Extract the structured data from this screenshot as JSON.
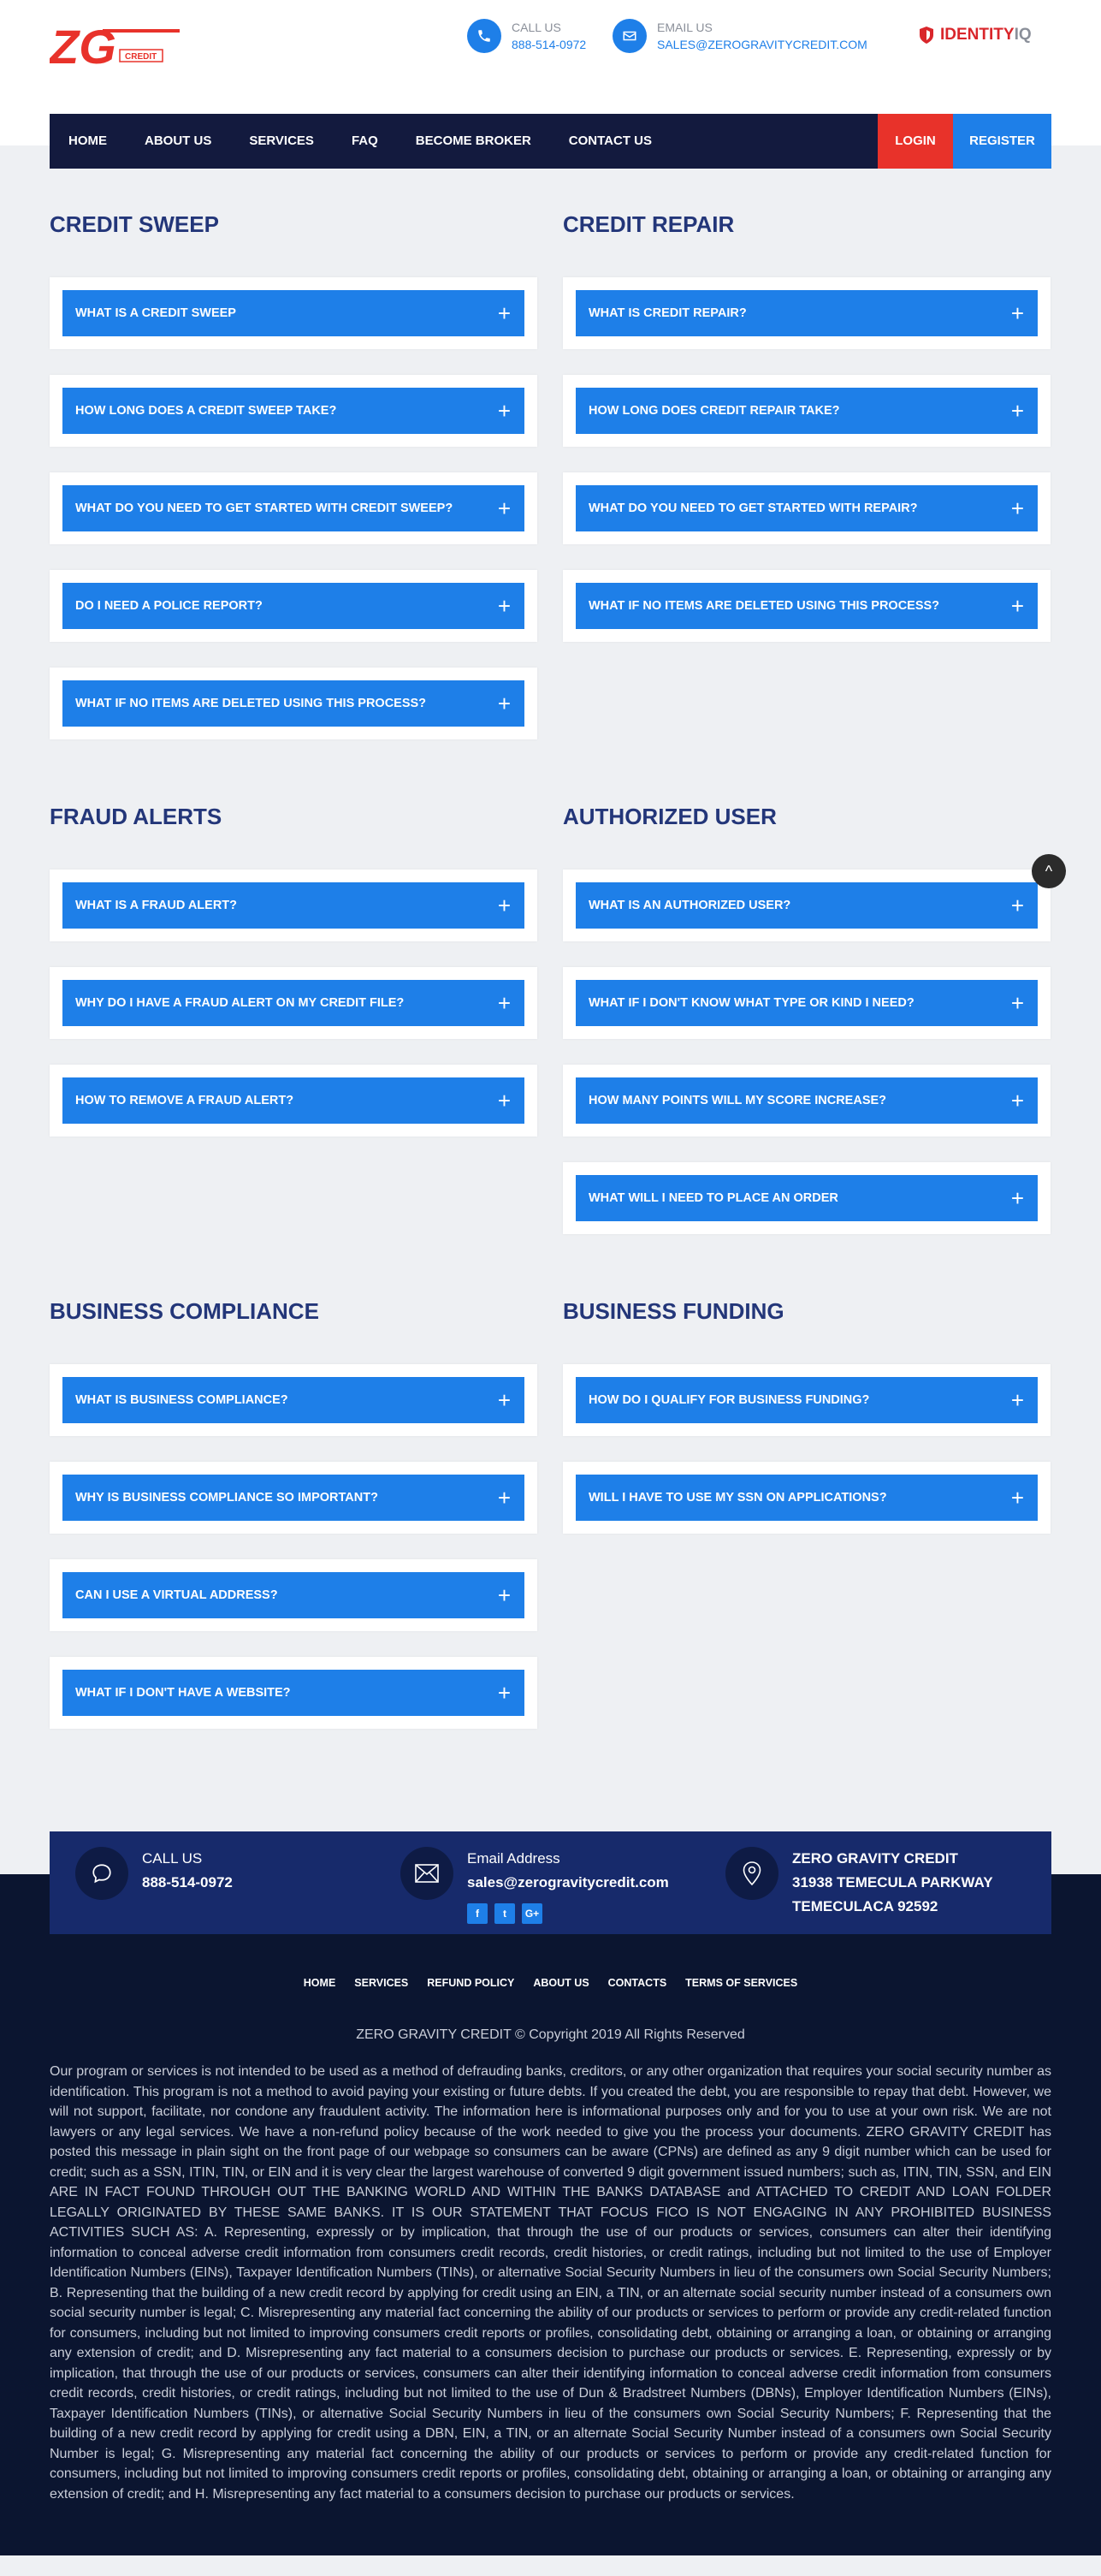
{
  "header": {
    "logo_text": "ZG",
    "logo_sub": "CREDIT",
    "call_label": "CALL US",
    "call_value": "888-514-0972",
    "email_label": "EMAIL US",
    "email_value": "SALES@ZEROGRAVITYCREDIT.COM",
    "identity_word": "IDENTITY",
    "identity_iq": "IQ"
  },
  "nav": {
    "items": [
      "HOME",
      "ABOUT US",
      "SERVICES",
      "FAQ",
      "BECOME BROKER",
      "CONTACT US"
    ],
    "login": "LOGIN",
    "register": "REGISTER"
  },
  "sections": [
    {
      "left": {
        "title": "CREDIT SWEEP",
        "questions": [
          "WHAT IS A CREDIT SWEEP",
          "HOW LONG DOES A CREDIT SWEEP TAKE?",
          "WHAT DO YOU NEED TO GET STARTED WITH CREDIT SWEEP?",
          "DO I NEED A POLICE REPORT?",
          "WHAT IF NO ITEMS ARE DELETED USING THIS PROCESS?"
        ]
      },
      "right": {
        "title": "CREDIT REPAIR",
        "questions": [
          "WHAT IS CREDIT REPAIR?",
          "HOW LONG DOES CREDIT REPAIR TAKE?",
          "WHAT DO YOU NEED TO GET STARTED WITH REPAIR?",
          "WHAT IF NO ITEMS ARE DELETED USING THIS PROCESS?"
        ]
      }
    },
    {
      "left": {
        "title": "FRAUD ALERTS",
        "questions": [
          "WHAT IS A FRAUD ALERT?",
          "WHY DO I HAVE A FRAUD ALERT ON MY CREDIT FILE?",
          "HOW TO REMOVE A FRAUD ALERT?"
        ]
      },
      "right": {
        "title": "AUTHORIZED USER",
        "questions": [
          "WHAT IS AN AUTHORIZED USER?",
          "WHAT IF I DON'T KNOW WHAT TYPE OR KIND I NEED?",
          "HOW MANY POINTS WILL MY SCORE INCREASE?",
          "WHAT WILL I NEED TO PLACE AN ORDER"
        ]
      }
    },
    {
      "left": {
        "title": "BUSINESS COMPLIANCE",
        "questions": [
          "WHAT IS BUSINESS COMPLIANCE?",
          "WHY IS BUSINESS COMPLIANCE SO IMPORTANT?",
          "CAN I USE A VIRTUAL ADDRESS?",
          "WHAT IF I DON'T HAVE A WEBSITE?"
        ]
      },
      "right": {
        "title": "BUSINESS FUNDING",
        "questions": [
          "HOW DO I QUALIFY FOR BUSINESS FUNDING?",
          "WILL I HAVE TO USE MY SSN ON APPLICATIONS?"
        ]
      }
    }
  ],
  "scroll_top": "^",
  "footer": {
    "call_title": "CALL US",
    "call_value": "888-514-0972",
    "email_title": "Email Address",
    "email_value": "sales@zerogravitycredit.com",
    "company": "ZERO GRAVITY CREDIT",
    "address1": "31938 TEMECULA PARKWAY",
    "address2": "TEMECULACA 92592",
    "social": [
      "f",
      "t",
      "G+"
    ],
    "links": [
      "HOME",
      "SERVICES",
      "REFUND POLICY",
      "ABOUT US",
      "CONTACTS",
      "TERMS OF SERVICES"
    ],
    "copyright": "ZERO GRAVITY CREDIT © Copyright 2019 All Rights Reserved",
    "disclaimer": "Our program or services is not intended to be used as a method of defrauding banks, creditors, or any other organization that requires your social security number as identification. This program is not a method to avoid paying your existing or future debts. If you created the debt, you are responsible to repay that debt. However, we will not support, facilitate, nor condone any fraudulent activity. The information here is informational purposes only and for you to use at your own risk. We are not lawyers or any legal services. We have a non-refund policy because of the work needed to give you the process your documents. ZERO GRAVITY CREDIT  has posted this message in plain sight on the front page of our webpage so consumers can be aware (CPNs) are defined as any 9 digit number which can be used for credit; such as a SSN, ITIN, TIN, or EIN and it is very clear the largest warehouse of converted 9 digit government issued numbers; such as, ITIN, TIN, SSN, and EIN ARE IN FACT FOUND THROUGH OUT THE BANKING WORLD AND WITHIN THE BANKS DATABASE and ATTACHED TO CREDIT AND LOAN FOLDER LEGALLY ORIGINATED BY THESE SAME BANKS. IT IS OUR STATEMENT THAT FOCUS FICO IS NOT ENGAGING IN ANY PROHIBITED BUSINESS ACTIVITIES SUCH AS: A. Representing, expressly or by implication, that through the use of our products or services, consumers can alter their identifying information to conceal adverse credit information from consumers credit records, credit histories, or credit ratings, including but not limited to the use of Employer Identification Numbers (EINs), Taxpayer Identification Numbers (TINs), or alternative Social Security Numbers in lieu of the consumers own Social Security Numbers; B. Representing that the building of a new credit record by applying for credit using an EIN, a TIN, or an alternate social security number instead of a consumers own social security number is legal; C. Misrepresenting any material fact concerning the ability of our products or services to perform or provide any credit-related function for consumers, including but not limited to improving consumers credit reports or profiles, consolidating debt, obtaining or arranging a loan, or obtaining or arranging any extension of credit; and D. Misrepresenting any fact material to a consumers decision to purchase our products or services. E. Representing, expressly or by implication, that through the use of our products or services, consumers can alter their identifying information to conceal adverse credit information from consumers credit records, credit histories, or credit ratings, including but not limited to the use of Dun & Bradstreet Numbers (DBNs), Employer Identification Numbers (EINs), Taxpayer Identification Numbers (TINs), or alternative Social Security Numbers in lieu of the consumers own Social Security Numbers; F. Representing that the building of a new credit record by applying for credit using a DBN, EIN, a TIN, or an alternate Social Security Number instead of a consumers own Social Security Number is legal; G. Misrepresenting any material fact concerning the ability of our products or services to perform or provide any credit-related function for consumers, including but not limited to improving consumers credit reports or profiles, consolidating debt, obtaining or arranging a loan, or obtaining or arranging any extension of credit; and H. Misrepresenting any fact material to a consumers decision to purchase our products or services."
  },
  "colors": {
    "accent": "#1e7fe8",
    "navy": "#131a3e",
    "heading": "#233679",
    "login": "#e8322a",
    "footer_bg": "#0b1530",
    "footer_bar": "#172a6b"
  }
}
